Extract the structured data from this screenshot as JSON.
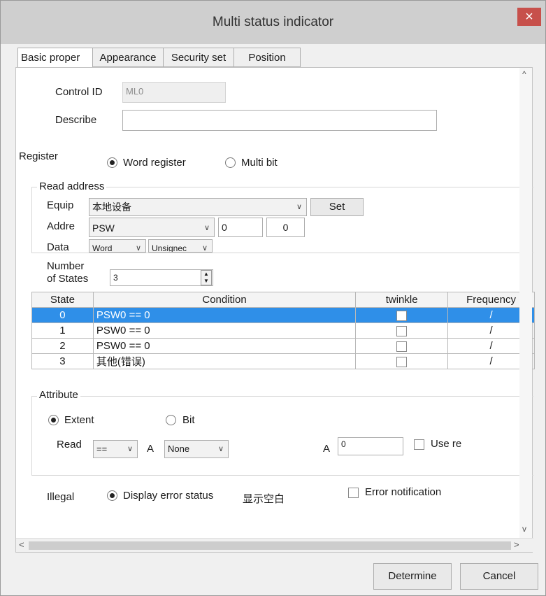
{
  "window": {
    "title": "Multi status indicator",
    "close_glyph": "×"
  },
  "tabs": [
    {
      "label": "Basic proper"
    },
    {
      "label": "Appearance"
    },
    {
      "label": "Security set"
    },
    {
      "label": "Position"
    }
  ],
  "form": {
    "control_id_label": "Control ID",
    "control_id_value": "ML0",
    "describe_label": "Describe",
    "describe_value": "",
    "register_label": "Register",
    "register_options": [
      "Word register",
      "Multi bit"
    ],
    "register_selected": "Word register"
  },
  "read_address": {
    "legend": "Read address",
    "equip_label": "Equip",
    "equip_value": "本地设备",
    "set_button": "Set",
    "addre_label": "Addre",
    "addre_type": "PSW",
    "addre_value1": "0",
    "addre_value2": "0",
    "data_label": "Data",
    "data_type": "Word",
    "data_sign": "Unsignec"
  },
  "states": {
    "number_label_1": "Number",
    "number_label_2": "of States",
    "number_value": "3",
    "columns": [
      "State",
      "Condition",
      "twinkle",
      "Frequency"
    ],
    "rows": [
      {
        "state": "0",
        "condition": "PSW0 == 0",
        "frequency": "/",
        "selected": true
      },
      {
        "state": "1",
        "condition": "PSW0 == 0",
        "frequency": "/",
        "selected": false
      },
      {
        "state": "2",
        "condition": "PSW0 == 0",
        "frequency": "/",
        "selected": false
      },
      {
        "state": "3",
        "condition": "其他(错误)",
        "frequency": "/",
        "selected": false
      }
    ]
  },
  "attribute": {
    "legend": "Attribute",
    "options": [
      "Extent",
      "Bit"
    ],
    "selected": "Extent",
    "read_label": "Read",
    "operator": "==",
    "a_label": "A",
    "a_select": "None",
    "a2_label": "A",
    "a2_value": "0",
    "use_label": "Use re"
  },
  "illegal": {
    "label": "Illegal",
    "option": "Display error status",
    "alt_text": "显示空白",
    "error_notification_label": "Error notification"
  },
  "scroll": {
    "up": "^",
    "down": "v",
    "left": "<",
    "right": ">"
  },
  "footer": {
    "determine": "Determine",
    "cancel": "Cancel"
  },
  "colors": {
    "selection": "#2f8fe8",
    "close_button": "#c7504b"
  }
}
